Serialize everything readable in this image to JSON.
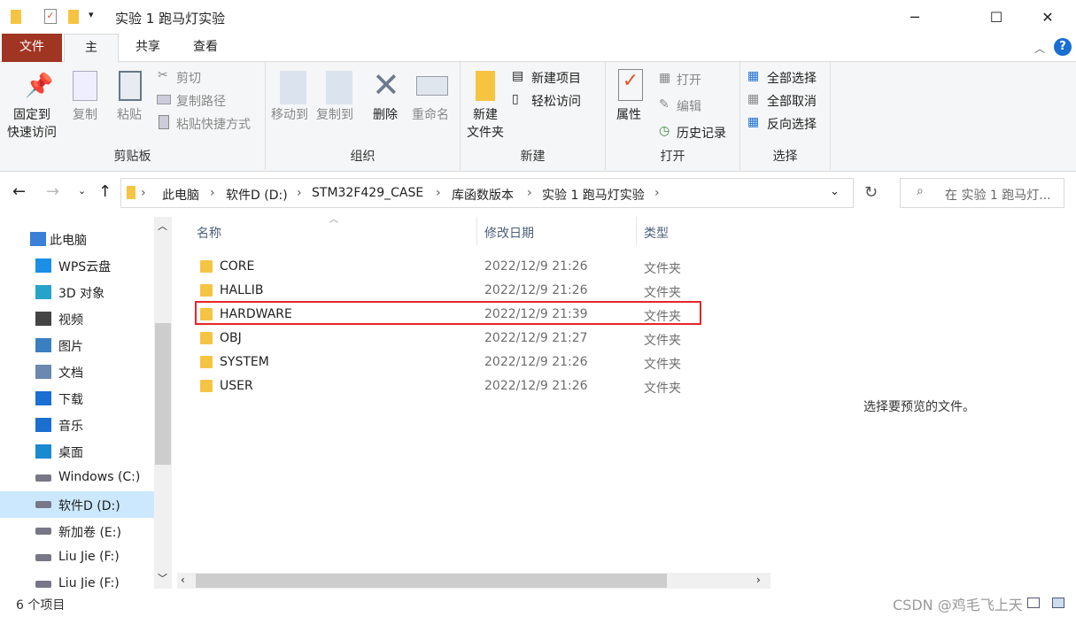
{
  "window": {
    "title": "实验 1 跑马灯实验",
    "minimize": "─",
    "maximize": "☐",
    "close": "✕"
  },
  "tabs": [
    {
      "label": "文件"
    },
    {
      "label": "主页"
    },
    {
      "label": "共享"
    },
    {
      "label": "查看"
    }
  ],
  "ribbon": {
    "clipboard": {
      "label": "剪贴板",
      "pin_line1": "固定到",
      "pin_line2": "快速访问",
      "copy": "复制",
      "paste": "粘贴",
      "cut": "剪切",
      "copy_path": "复制路径",
      "paste_shortcut": "粘贴快捷方式"
    },
    "organize": {
      "label": "组织",
      "move_to": "移动到",
      "copy_to": "复制到",
      "delete": "删除",
      "rename": "重命名"
    },
    "new": {
      "label": "新建",
      "new_folder_line1": "新建",
      "new_folder_line2": "文件夹",
      "new_item": "新建项目",
      "easy_access": "轻松访问"
    },
    "open": {
      "label": "打开",
      "properties": "属性",
      "open": "打开",
      "edit": "编辑",
      "history": "历史记录"
    },
    "select": {
      "label": "选择",
      "select_all": "全部选择",
      "select_none": "全部取消",
      "invert": "反向选择"
    }
  },
  "address": {
    "crumbs": [
      "此电脑",
      "软件D (D:)",
      "STM32F429_CASE",
      "库函数版本",
      "实验 1 跑马灯实验"
    ],
    "search_placeholder": "在 实验 1 跑马灯..."
  },
  "nav": [
    {
      "label": "此电脑"
    },
    {
      "label": "WPS云盘"
    },
    {
      "label": "3D 对象"
    },
    {
      "label": "视频"
    },
    {
      "label": "图片"
    },
    {
      "label": "文档"
    },
    {
      "label": "下载"
    },
    {
      "label": "音乐"
    },
    {
      "label": "桌面"
    },
    {
      "label": "Windows (C:)"
    },
    {
      "label": "软件D (D:)"
    },
    {
      "label": "新加卷 (E:)"
    },
    {
      "label": "Liu Jie  (F:)"
    },
    {
      "label": "Liu Jie  (F:)"
    }
  ],
  "columns": {
    "name": "名称",
    "date": "修改日期",
    "type": "类型"
  },
  "files": [
    {
      "name": "CORE",
      "date": "2022/12/9 21:26",
      "type": "文件夹"
    },
    {
      "name": "HALLIB",
      "date": "2022/12/9 21:26",
      "type": "文件夹"
    },
    {
      "name": "HARDWARE",
      "date": "2022/12/9 21:39",
      "type": "文件夹"
    },
    {
      "name": "OBJ",
      "date": "2022/12/9 21:27",
      "type": "文件夹"
    },
    {
      "name": "SYSTEM",
      "date": "2022/12/9 21:26",
      "type": "文件夹"
    },
    {
      "name": "USER",
      "date": "2022/12/9 21:26",
      "type": "文件夹"
    }
  ],
  "preview": {
    "message": "选择要预览的文件。"
  },
  "status": {
    "count": "6 个项目"
  },
  "watermark": "CSDN @鸡毛飞上天",
  "colors": {
    "file_tab": "#a03523",
    "highlight_box": "#e5262b",
    "folder": "#f6c443"
  }
}
